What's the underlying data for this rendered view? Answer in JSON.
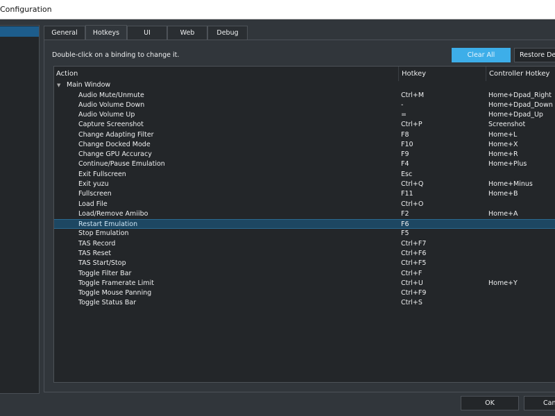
{
  "window": {
    "title": "Configuration"
  },
  "tabs": [
    "General",
    "Hotkeys",
    "UI",
    "Web",
    "Debug"
  ],
  "active_tab": "Hotkeys",
  "hint": "Double-click on a binding to change it.",
  "buttons": {
    "clear_all": "Clear All",
    "restore_defaults": "Restore Defaults",
    "ok": "OK",
    "cancel": "Cancel"
  },
  "table": {
    "headers": [
      "Action",
      "Hotkey",
      "Controller Hotkey"
    ],
    "group": "Main Window",
    "rows": [
      {
        "action": "Audio Mute/Unmute",
        "hotkey": "Ctrl+M",
        "controller": "Home+Dpad_Right"
      },
      {
        "action": "Audio Volume Down",
        "hotkey": "-",
        "controller": "Home+Dpad_Down"
      },
      {
        "action": "Audio Volume Up",
        "hotkey": "=",
        "controller": "Home+Dpad_Up"
      },
      {
        "action": "Capture Screenshot",
        "hotkey": "Ctrl+P",
        "controller": "Screenshot"
      },
      {
        "action": "Change Adapting Filter",
        "hotkey": "F8",
        "controller": "Home+L"
      },
      {
        "action": "Change Docked Mode",
        "hotkey": "F10",
        "controller": "Home+X"
      },
      {
        "action": "Change GPU Accuracy",
        "hotkey": "F9",
        "controller": "Home+R"
      },
      {
        "action": "Continue/Pause Emulation",
        "hotkey": "F4",
        "controller": "Home+Plus"
      },
      {
        "action": "Exit Fullscreen",
        "hotkey": "Esc",
        "controller": ""
      },
      {
        "action": "Exit yuzu",
        "hotkey": "Ctrl+Q",
        "controller": "Home+Minus"
      },
      {
        "action": "Fullscreen",
        "hotkey": "F11",
        "controller": "Home+B"
      },
      {
        "action": "Load File",
        "hotkey": "Ctrl+O",
        "controller": ""
      },
      {
        "action": "Load/Remove Amiibo",
        "hotkey": "F2",
        "controller": "Home+A"
      },
      {
        "action": "Restart Emulation",
        "hotkey": "F6",
        "controller": ""
      },
      {
        "action": "Stop Emulation",
        "hotkey": "F5",
        "controller": ""
      },
      {
        "action": "TAS Record",
        "hotkey": "Ctrl+F7",
        "controller": ""
      },
      {
        "action": "TAS Reset",
        "hotkey": "Ctrl+F6",
        "controller": ""
      },
      {
        "action": "TAS Start/Stop",
        "hotkey": "Ctrl+F5",
        "controller": ""
      },
      {
        "action": "Toggle Filter Bar",
        "hotkey": "Ctrl+F",
        "controller": ""
      },
      {
        "action": "Toggle Framerate Limit",
        "hotkey": "Ctrl+U",
        "controller": "Home+Y"
      },
      {
        "action": "Toggle Mouse Panning",
        "hotkey": "Ctrl+F9",
        "controller": ""
      },
      {
        "action": "Toggle Status Bar",
        "hotkey": "Ctrl+S",
        "controller": ""
      }
    ],
    "selected_index": 13
  }
}
